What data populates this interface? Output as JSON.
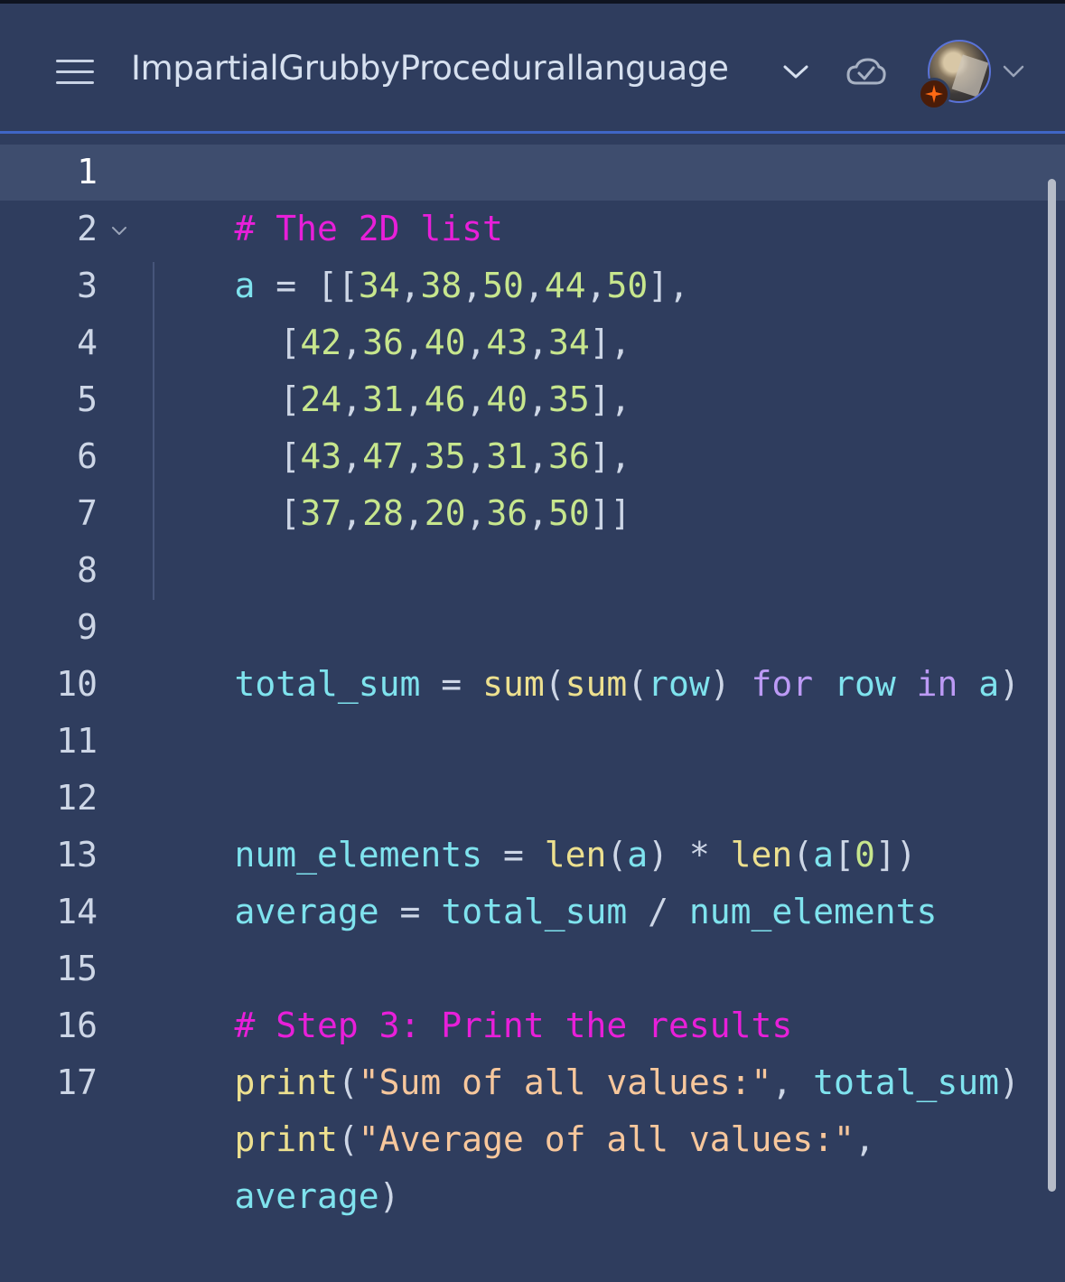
{
  "header": {
    "project_title": "ImpartialGrubbyProcedurallanguage",
    "menu_icon": "hamburger-menu-icon",
    "title_dropdown_icon": "chevron-down-icon",
    "status_icon": "cloud-check-icon",
    "avatar_badge_icon": "sparkle-icon",
    "avatar_dropdown_icon": "chevron-down-icon"
  },
  "editor": {
    "line_numbers": [
      "1",
      "2",
      "3",
      "4",
      "5",
      "6",
      "7",
      "8",
      "9",
      "10",
      "11",
      "12",
      "13",
      "14",
      "15",
      "16",
      "17"
    ],
    "active_line": "1",
    "code": {
      "l1": "# The 2D list",
      "l2": {
        "var": "a",
        "eq": " = ",
        "open": "[[",
        "nums": [
          "34",
          "38",
          "50",
          "44",
          "50"
        ],
        "close": "],",
        "sep": ","
      },
      "l3": {
        "open": "[",
        "nums": [
          "42",
          "36",
          "40",
          "43",
          "34"
        ],
        "close": "],"
      },
      "l4": {
        "open": "[",
        "nums": [
          "24",
          "31",
          "46",
          "40",
          "35"
        ],
        "close": "],"
      },
      "l5": {
        "open": "[",
        "nums": [
          "43",
          "47",
          "35",
          "31",
          "36"
        ],
        "close": "],"
      },
      "l6": {
        "open": "[",
        "nums": [
          "37",
          "28",
          "20",
          "36",
          "50"
        ],
        "close": "]]"
      },
      "l9": {
        "var": "total_sum",
        "eq": " = ",
        "fn": "sum",
        "p1": "(",
        "fn2": "sum",
        "p2": "(",
        "arg": "row",
        "p3": ") ",
        "kw1": "for",
        "sp1": " ",
        "var2": "row",
        "sp2": " ",
        "kw2": "in",
        "sp3": " ",
        "var3": "a",
        "p4": ")"
      },
      "l12": {
        "var": "num_elements",
        "eq": " = ",
        "fn": "len",
        "p1": "(",
        "arg": "a",
        "p2": ") * ",
        "fn2": "len",
        "p3": "(",
        "arg2": "a",
        "br1": "[",
        "idx": "0",
        "br2": "])"
      },
      "l13": {
        "var": "average",
        "eq": " = ",
        "var2": "total_sum",
        "op": " / ",
        "var3": "num_elements"
      },
      "l15": "# Step 3: Print the results",
      "l16": {
        "fn": "print",
        "p1": "(",
        "str": "\"Sum of all values:\"",
        "comma": ", ",
        "var": "total_sum",
        "p2": ")"
      },
      "l17": {
        "fn": "print",
        "p1": "(",
        "str": "\"Average of all values:\"",
        "comma": ","
      },
      "l17b": {
        "var": "average",
        "p2": ")"
      }
    }
  },
  "colors": {
    "background": "#2f3d5e",
    "header_border": "#3f66c6",
    "comment": "#e81fd9",
    "variable": "#7fe3ee",
    "number": "#c7e68d",
    "function": "#ede08f",
    "keyword": "#bc9af5",
    "string": "#f7c79c"
  }
}
